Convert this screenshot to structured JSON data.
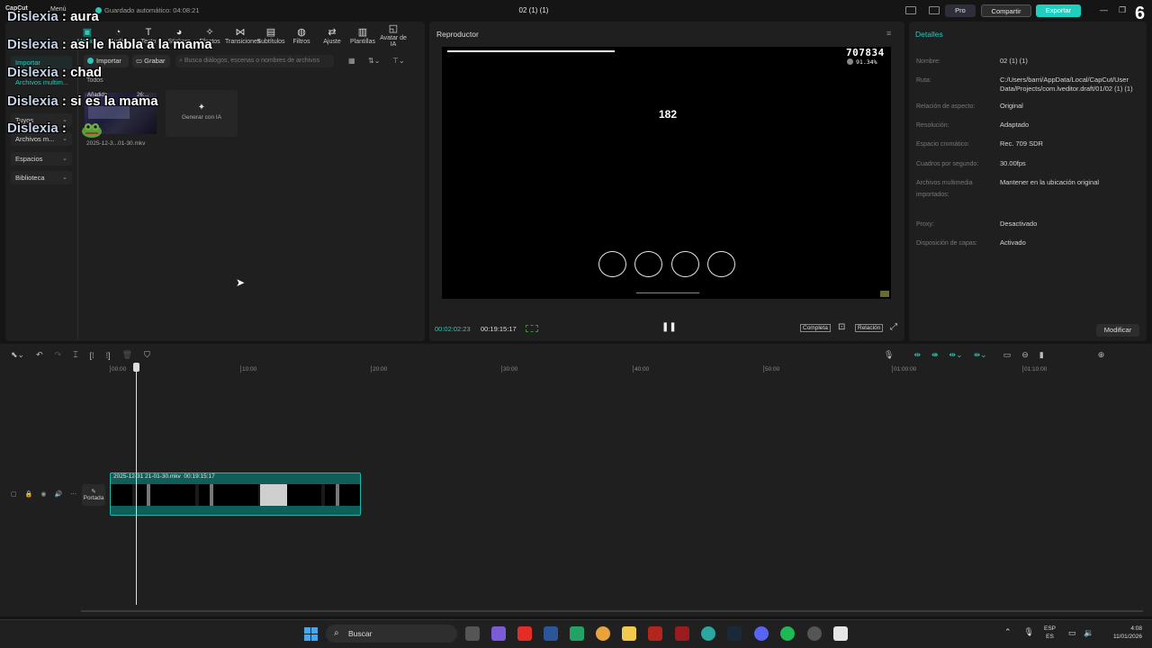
{
  "app": {
    "logo": "CapCut",
    "menu_label": "Menú",
    "autosave": "Guardado automático: 04:08:21",
    "project_title": "02 (1) (1)",
    "pro_label": "Pro",
    "share_label": "Compartir",
    "export_label": "Exportar",
    "overlay_number": "6",
    "accent_color": "#2cc7b8"
  },
  "toolbar": {
    "items": [
      {
        "label": "Medios",
        "icon": "media-icon"
      },
      {
        "label": "Audio",
        "icon": "audio-icon"
      },
      {
        "label": "Texto",
        "icon": "text-icon"
      },
      {
        "label": "Stickers",
        "icon": "sticker-icon"
      },
      {
        "label": "Efectos",
        "icon": "effects-icon"
      },
      {
        "label": "Transiciones",
        "icon": "transitions-icon"
      },
      {
        "label": "Subtítulos",
        "icon": "subtitles-icon"
      },
      {
        "label": "Filtros",
        "icon": "filters-icon"
      },
      {
        "label": "Ajuste",
        "icon": "adjust-icon"
      },
      {
        "label": "Plantillas",
        "icon": "templates-icon"
      },
      {
        "label": "Avatar de IA",
        "icon": "ai-avatar-icon"
      }
    ]
  },
  "sidebar": {
    "items": [
      {
        "label": "Importar"
      },
      {
        "label": "Archivos multim..."
      },
      {
        "label": "Tuyos"
      },
      {
        "label": "Archivos m..."
      },
      {
        "label": "Espacios"
      },
      {
        "label": "Biblioteca"
      }
    ]
  },
  "media": {
    "import_label": "Importar",
    "record_label": "Grabar",
    "search_placeholder": "Busca diálogos, escenas o nombres de archivos",
    "filter_label": "Todos",
    "clip_badge": "Añadido",
    "clip_duration": "26:...",
    "clip_name": "2025-12-3...01-30.mkv",
    "generate_label": "Generar con IA"
  },
  "chat": [
    {
      "user": "Dislexia",
      "message": "aura"
    },
    {
      "user": "Dislexia",
      "message": "asi le habla a la mama"
    },
    {
      "user": "Dislexia",
      "message": "chad"
    },
    {
      "user": "Dislexia",
      "message": "si es la mama"
    },
    {
      "user": "Dislexia",
      "message": ""
    }
  ],
  "player": {
    "title": "Reproductor",
    "score": "707834",
    "accuracy": "91.34%",
    "combo": "182",
    "time_current": "00:02:02:23",
    "time_total": "00:19:15:17",
    "full_label": "Completa",
    "ratio_label": "Relación",
    "receptor_count": 4
  },
  "details": {
    "title": "Detalles",
    "fields": [
      {
        "label": "Nombre:",
        "value": "02 (1) (1)"
      },
      {
        "label": "Ruta:",
        "value": "C:/Users/barri/AppData/Local/CapCut/User Data/Projects/com.lveditor.draft/01/02 (1) (1)"
      },
      {
        "label": "Relación de aspecto:",
        "value": "Original"
      },
      {
        "label": "Resolución:",
        "value": "Adaptado"
      },
      {
        "label": "Espacio cromático:",
        "value": "Rec. 709 SDR"
      },
      {
        "label": "Cuadros por segundo:",
        "value": "30.00fps"
      },
      {
        "label": "Archivos multimedia importados:",
        "value": "Mantener en la ubicación original"
      },
      {
        "label": "Proxy:",
        "value": "Desactivado"
      },
      {
        "label": "Disposición de capas:",
        "value": "Activado"
      }
    ],
    "modify_label": "Modificar"
  },
  "timeline": {
    "marks": [
      "00:00",
      "10:00",
      "20:00",
      "30:00",
      "40:00",
      "50:00",
      "01:00:00",
      "01:10:00"
    ],
    "clip_label": "2025-12-31 21-01-30.mkv",
    "clip_duration": "00:19:15:17",
    "cover_label": "Portada"
  },
  "taskbar": {
    "search_label": "Buscar",
    "lang_top": "ESP",
    "lang_bottom": "ES",
    "time": "4:08",
    "date": "11/01/2026"
  }
}
